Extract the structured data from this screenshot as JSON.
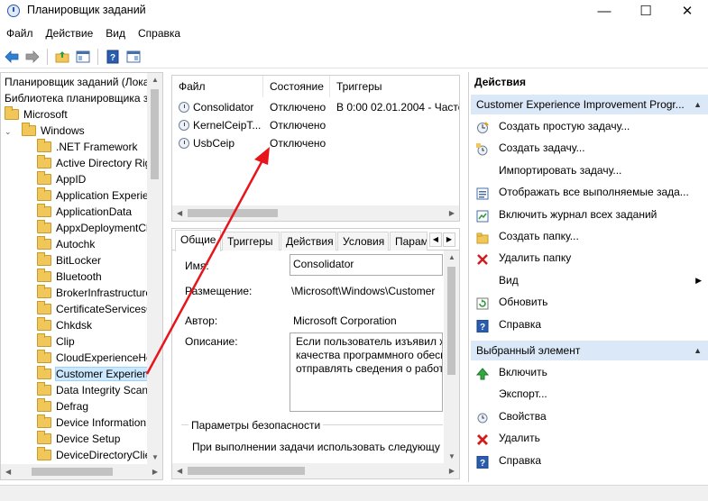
{
  "window": {
    "title": "Планировщик заданий",
    "minimize": "—",
    "maximize": "☐",
    "close": "✕"
  },
  "menu": [
    "Файл",
    "Действие",
    "Вид",
    "Справка"
  ],
  "tree": {
    "items": [
      {
        "label": "Планировщик заданий (Локальн",
        "level": 0,
        "folder": false
      },
      {
        "label": "Библиотека планировщика зада",
        "level": 0,
        "folder": false
      },
      {
        "label": "Microsoft",
        "level": 0,
        "folder": true
      },
      {
        "label": "Windows",
        "level": 1,
        "folder": true,
        "expander": "⌄"
      },
      {
        "label": ".NET Framework",
        "level": 2,
        "folder": true
      },
      {
        "label": "Active Directory Rig",
        "level": 2,
        "folder": true
      },
      {
        "label": "AppID",
        "level": 2,
        "folder": true
      },
      {
        "label": "Application Experie",
        "level": 2,
        "folder": true
      },
      {
        "label": "ApplicationData",
        "level": 2,
        "folder": true
      },
      {
        "label": "AppxDeploymentCl",
        "level": 2,
        "folder": true
      },
      {
        "label": "Autochk",
        "level": 2,
        "folder": true
      },
      {
        "label": "BitLocker",
        "level": 2,
        "folder": true
      },
      {
        "label": "Bluetooth",
        "level": 2,
        "folder": true
      },
      {
        "label": "BrokerInfrastructure",
        "level": 2,
        "folder": true
      },
      {
        "label": "CertificateServicesC",
        "level": 2,
        "folder": true
      },
      {
        "label": "Chkdsk",
        "level": 2,
        "folder": true
      },
      {
        "label": "Clip",
        "level": 2,
        "folder": true
      },
      {
        "label": "CloudExperienceHo",
        "level": 2,
        "folder": true
      },
      {
        "label": "Customer Experienc",
        "level": 2,
        "folder": true,
        "selected": true
      },
      {
        "label": "Data Integrity Scan",
        "level": 2,
        "folder": true
      },
      {
        "label": "Defrag",
        "level": 2,
        "folder": true
      },
      {
        "label": "Device Information",
        "level": 2,
        "folder": true
      },
      {
        "label": "Device Setup",
        "level": 2,
        "folder": true
      },
      {
        "label": "DeviceDirectoryClie",
        "level": 2,
        "folder": true
      }
    ]
  },
  "tasklist": {
    "columns": [
      "Файл",
      "Состояние",
      "Триггеры"
    ],
    "rows": [
      {
        "name": "Consolidator",
        "state": "Отключено",
        "trigger": "В 0:00 02.01.2004 - Часто"
      },
      {
        "name": "KernelCeipT...",
        "state": "Отключено",
        "trigger": ""
      },
      {
        "name": "UsbCeip",
        "state": "Отключено",
        "trigger": ""
      }
    ]
  },
  "details": {
    "tabs": [
      "Общие",
      "Триггеры",
      "Действия",
      "Условия",
      "Парам"
    ],
    "name_label": "Имя:",
    "name_value": "Consolidator",
    "location_label": "Размещение:",
    "location_value": "\\Microsoft\\Windows\\Customer",
    "author_label": "Автор:",
    "author_value": "Microsoft Corporation",
    "description_label": "Описание:",
    "description_lines": [
      "Если пользователь изъявил ж",
      "качества программного обесп",
      "отправлять сведения о работ"
    ],
    "security_title": "Параметры безопасности",
    "security_text": "При выполнении задачи использовать следующу"
  },
  "actions": {
    "title": "Действия",
    "group1": "Customer Experience Improvement Progr...",
    "group1_items": [
      {
        "label": "Создать простую задачу...",
        "icon": "create-basic-task-icon"
      },
      {
        "label": "Создать задачу...",
        "icon": "create-task-icon"
      },
      {
        "label": "Импортировать задачу...",
        "icon": ""
      },
      {
        "label": "Отображать все выполняемые зада...",
        "icon": "running-tasks-icon"
      },
      {
        "label": "Включить журнал всех заданий",
        "icon": "history-log-icon"
      },
      {
        "label": "Создать папку...",
        "icon": "new-folder-icon"
      },
      {
        "label": "Удалить папку",
        "icon": "delete-folder-icon"
      },
      {
        "label": "Вид",
        "icon": "",
        "submenu": true
      },
      {
        "label": "Обновить",
        "icon": "refresh-icon"
      },
      {
        "label": "Справка",
        "icon": "help-icon"
      }
    ],
    "group2": "Выбранный элемент",
    "group2_items": [
      {
        "label": "Включить",
        "icon": "enable-icon"
      },
      {
        "label": "Экспорт...",
        "icon": ""
      },
      {
        "label": "Свойства",
        "icon": "properties-icon"
      },
      {
        "label": "Удалить",
        "icon": "delete-icon"
      },
      {
        "label": "Справка",
        "icon": "help-icon"
      }
    ]
  },
  "colors": {
    "group_header": "#dbe8f7",
    "annotation_arrow": "#e8141c",
    "selection": "#cce8ff"
  }
}
